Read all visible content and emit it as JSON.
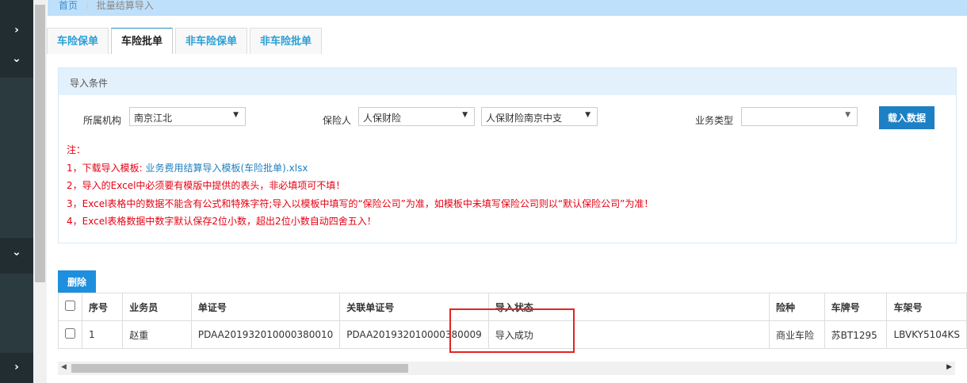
{
  "breadcrumb": {
    "home": "首页",
    "sep": "/",
    "current": "批量结算导入"
  },
  "tabs": [
    {
      "label": "车险保单"
    },
    {
      "label": "车险批单"
    },
    {
      "label": "非车险保单"
    },
    {
      "label": "非车险批单"
    }
  ],
  "panel": {
    "title": "导入条件",
    "org_label": "所属机构",
    "org_value": "南京江北",
    "insurer_label": "保险人",
    "insurer_value": "人保财险",
    "branch_value": "人保财险南京中支",
    "biz_type_label": "业务类型",
    "biz_type_value": "",
    "load_button": "载入数据",
    "notes": {
      "title": "注：",
      "n1_prefix": "1，下载导入模板: ",
      "n1_link": "业务费用结算导入模板(车险批单).xlsx",
      "n2": "2，导入的Excel中必须要有模版中提供的表头，非必填项可不填！",
      "n3": "3，Excel表格中的数据不能含有公式和特殊字符;导入以模板中填写的“保险公司”为准，如模板中未填写保险公司则以“默认保险公司”为准！",
      "n4": "4，Excel表格数据中数字默认保存2位小数，超出2位小数自动四舍五入！"
    }
  },
  "delete_button": "删除",
  "table": {
    "headers": [
      "序号",
      "业务员",
      "单证号",
      "关联单证号",
      "导入状态",
      "险种",
      "车牌号",
      "车架号"
    ],
    "rows": [
      [
        "1",
        "赵重",
        "PDAA201932010000380010",
        "PDAA201932010000380009",
        "导入成功",
        "商业车险",
        "苏BT1295",
        "LBVKY5104KS"
      ]
    ]
  }
}
